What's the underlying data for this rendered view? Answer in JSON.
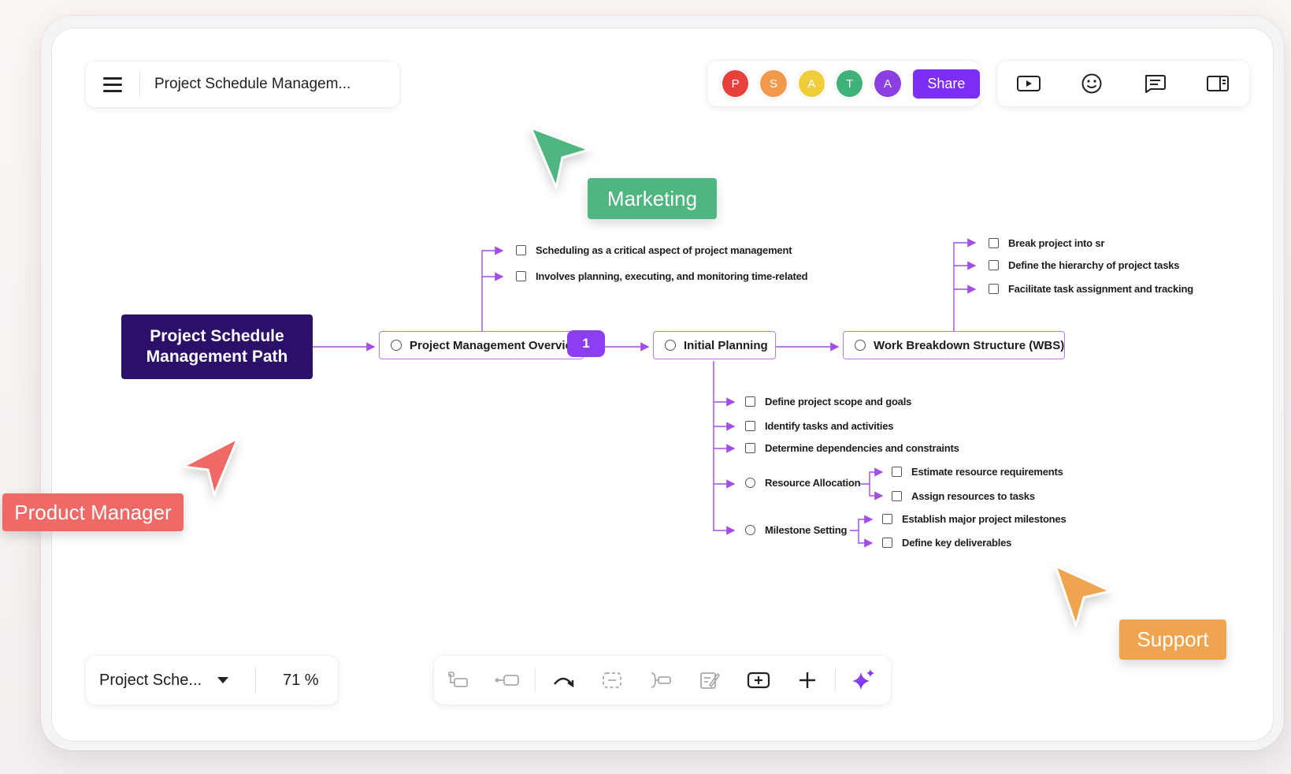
{
  "header": {
    "doc_title": "Project Schedule Managem...",
    "share_label": "Share",
    "collaborators": [
      {
        "initial": "P",
        "color": "#e8413c"
      },
      {
        "initial": "S",
        "color": "#f39a4a"
      },
      {
        "initial": "A",
        "color": "#f2cd3a"
      },
      {
        "initial": "T",
        "color": "#3fb27a"
      },
      {
        "initial": "A",
        "color": "#8b3fe0"
      }
    ],
    "tools": [
      "present-icon",
      "emoji-icon",
      "comment-icon",
      "panel-icon"
    ]
  },
  "footer": {
    "map_name": "Project Sche...",
    "zoom": "71 %",
    "toolbar": [
      "add-sibling-icon",
      "add-child-icon",
      "relationship-icon",
      "summary-icon",
      "boundary-icon",
      "note-icon",
      "insert-topic-icon",
      "plus-icon",
      "ai-sparkle-icon"
    ]
  },
  "mindmap": {
    "root": "Project Schedule Management Path",
    "overview": "Project Management Overview",
    "overview_badge": "1",
    "overview_children": [
      "Scheduling as a critical aspect of project management",
      "Involves planning, executing, and monitoring time-related as"
    ],
    "initial_planning": "Initial Planning",
    "planning_children": [
      "Define project scope and goals",
      "Identify tasks and activities",
      "Determine dependencies and constraints"
    ],
    "resource_allocation": "Resource Allocation",
    "resource_children": [
      "Estimate resource requirements",
      "Assign resources to tasks"
    ],
    "milestone_setting": "Milestone Setting",
    "milestone_children": [
      "Establish major project milestones",
      "Define key deliverables"
    ],
    "wbs": "Work Breakdown Structure (WBS)",
    "wbs_children": [
      "Break project into sr",
      "Define the hierarchy of project tasks",
      "Facilitate task assignment and tracking"
    ]
  },
  "cursors": {
    "marketing": {
      "label": "Marketing",
      "color": "#4fb680"
    },
    "product_manager": {
      "label": "Product Manager",
      "color": "#ef6a66"
    },
    "support": {
      "label": "Support",
      "color": "#efa550"
    }
  },
  "colors": {
    "accent": "#7b2ff2",
    "connector": "#a44ee8",
    "root_bg": "#2b1069"
  }
}
